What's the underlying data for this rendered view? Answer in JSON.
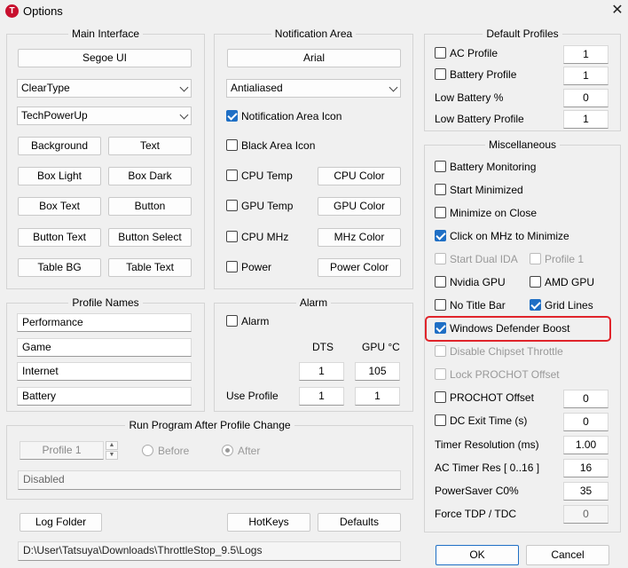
{
  "window": {
    "title": "Options",
    "app_icon": "T"
  },
  "main_interface": {
    "title": "Main Interface",
    "font": "Segoe UI",
    "rendering": "ClearType",
    "theme": "TechPowerUp",
    "buttons": [
      "Background",
      "Text",
      "Box Light",
      "Box Dark",
      "Box Text",
      "Button",
      "Button Text",
      "Button Select",
      "Table BG",
      "Table Text"
    ]
  },
  "notification_area": {
    "title": "Notification Area",
    "font": "Arial",
    "rendering": "Antialiased",
    "notification_icon": "Notification Area Icon",
    "black_icon": "Black Area Icon",
    "cpu_temp": "CPU Temp",
    "cpu_color": "CPU Color",
    "gpu_temp": "GPU Temp",
    "gpu_color": "GPU Color",
    "cpu_mhz": "CPU MHz",
    "mhz_color": "MHz Color",
    "power": "Power",
    "power_color": "Power Color"
  },
  "default_profiles": {
    "title": "Default Profiles",
    "ac_profile": "AC Profile",
    "ac_value": "1",
    "battery_profile": "Battery Profile",
    "battery_value": "1",
    "low_battery_pct": "Low Battery %",
    "low_battery_pct_value": "0",
    "low_battery_profile": "Low Battery Profile",
    "low_battery_profile_value": "1"
  },
  "misc": {
    "title": "Miscellaneous",
    "battery_monitoring": "Battery Monitoring",
    "start_minimized": "Start Minimized",
    "minimize_on_close": "Minimize on Close",
    "click_mhz": "Click on MHz to Minimize",
    "start_dual_ida": "Start Dual IDA",
    "profile_1": "Profile 1",
    "nvidia_gpu": "Nvidia GPU",
    "amd_gpu": "AMD GPU",
    "no_title_bar": "No Title Bar",
    "grid_lines": "Grid Lines",
    "defender_boost": "Windows Defender Boost",
    "disable_chipset": "Disable Chipset Throttle",
    "lock_prochot": "Lock PROCHOT Offset",
    "prochot_offset": "PROCHOT Offset",
    "prochot_value": "0",
    "dc_exit": "DC Exit Time (s)",
    "dc_exit_value": "0",
    "timer_res": "Timer Resolution (ms)",
    "timer_res_value": "1.00",
    "ac_timer": "AC Timer Res [ 0..16 ]",
    "ac_timer_value": "16",
    "powersaver": "PowerSaver C0%",
    "powersaver_value": "35",
    "force_tdp": "Force TDP / TDC",
    "force_tdp_value": "0"
  },
  "profile_names": {
    "title": "Profile Names",
    "names": [
      "Performance",
      "Game",
      "Internet",
      "Battery"
    ]
  },
  "alarm": {
    "title": "Alarm",
    "alarm_label": "Alarm",
    "dts": "DTS",
    "gpu_c": "GPU °C",
    "dts_value": "1",
    "gpu_value": "105",
    "use_profile": "Use Profile",
    "use_dts": "1",
    "use_gpu": "1"
  },
  "run_program": {
    "title": "Run Program After Profile Change",
    "profile": "Profile 1",
    "before": "Before",
    "after": "After",
    "status": "Disabled"
  },
  "bottom": {
    "log_folder": "Log Folder",
    "hotkeys": "HotKeys",
    "defaults": "Defaults",
    "ok": "OK",
    "cancel": "Cancel",
    "log_path": "D:\\User\\Tatsuya\\Downloads\\ThrottleStop_9.5\\Logs"
  },
  "colors": {
    "accent": "#1f6fc5",
    "highlight": "#e0242b"
  }
}
